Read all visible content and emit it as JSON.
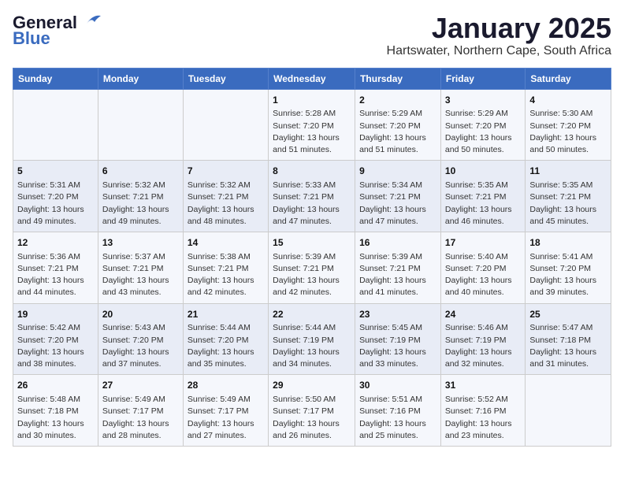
{
  "logo": {
    "line1": "General",
    "line2": "Blue"
  },
  "header": {
    "month": "January 2025",
    "location": "Hartswater, Northern Cape, South Africa"
  },
  "weekdays": [
    "Sunday",
    "Monday",
    "Tuesday",
    "Wednesday",
    "Thursday",
    "Friday",
    "Saturday"
  ],
  "weeks": [
    [
      {
        "day": "",
        "info": ""
      },
      {
        "day": "",
        "info": ""
      },
      {
        "day": "",
        "info": ""
      },
      {
        "day": "1",
        "info": "Sunrise: 5:28 AM\nSunset: 7:20 PM\nDaylight: 13 hours\nand 51 minutes."
      },
      {
        "day": "2",
        "info": "Sunrise: 5:29 AM\nSunset: 7:20 PM\nDaylight: 13 hours\nand 51 minutes."
      },
      {
        "day": "3",
        "info": "Sunrise: 5:29 AM\nSunset: 7:20 PM\nDaylight: 13 hours\nand 50 minutes."
      },
      {
        "day": "4",
        "info": "Sunrise: 5:30 AM\nSunset: 7:20 PM\nDaylight: 13 hours\nand 50 minutes."
      }
    ],
    [
      {
        "day": "5",
        "info": "Sunrise: 5:31 AM\nSunset: 7:20 PM\nDaylight: 13 hours\nand 49 minutes."
      },
      {
        "day": "6",
        "info": "Sunrise: 5:32 AM\nSunset: 7:21 PM\nDaylight: 13 hours\nand 49 minutes."
      },
      {
        "day": "7",
        "info": "Sunrise: 5:32 AM\nSunset: 7:21 PM\nDaylight: 13 hours\nand 48 minutes."
      },
      {
        "day": "8",
        "info": "Sunrise: 5:33 AM\nSunset: 7:21 PM\nDaylight: 13 hours\nand 47 minutes."
      },
      {
        "day": "9",
        "info": "Sunrise: 5:34 AM\nSunset: 7:21 PM\nDaylight: 13 hours\nand 47 minutes."
      },
      {
        "day": "10",
        "info": "Sunrise: 5:35 AM\nSunset: 7:21 PM\nDaylight: 13 hours\nand 46 minutes."
      },
      {
        "day": "11",
        "info": "Sunrise: 5:35 AM\nSunset: 7:21 PM\nDaylight: 13 hours\nand 45 minutes."
      }
    ],
    [
      {
        "day": "12",
        "info": "Sunrise: 5:36 AM\nSunset: 7:21 PM\nDaylight: 13 hours\nand 44 minutes."
      },
      {
        "day": "13",
        "info": "Sunrise: 5:37 AM\nSunset: 7:21 PM\nDaylight: 13 hours\nand 43 minutes."
      },
      {
        "day": "14",
        "info": "Sunrise: 5:38 AM\nSunset: 7:21 PM\nDaylight: 13 hours\nand 42 minutes."
      },
      {
        "day": "15",
        "info": "Sunrise: 5:39 AM\nSunset: 7:21 PM\nDaylight: 13 hours\nand 42 minutes."
      },
      {
        "day": "16",
        "info": "Sunrise: 5:39 AM\nSunset: 7:21 PM\nDaylight: 13 hours\nand 41 minutes."
      },
      {
        "day": "17",
        "info": "Sunrise: 5:40 AM\nSunset: 7:20 PM\nDaylight: 13 hours\nand 40 minutes."
      },
      {
        "day": "18",
        "info": "Sunrise: 5:41 AM\nSunset: 7:20 PM\nDaylight: 13 hours\nand 39 minutes."
      }
    ],
    [
      {
        "day": "19",
        "info": "Sunrise: 5:42 AM\nSunset: 7:20 PM\nDaylight: 13 hours\nand 38 minutes."
      },
      {
        "day": "20",
        "info": "Sunrise: 5:43 AM\nSunset: 7:20 PM\nDaylight: 13 hours\nand 37 minutes."
      },
      {
        "day": "21",
        "info": "Sunrise: 5:44 AM\nSunset: 7:20 PM\nDaylight: 13 hours\nand 35 minutes."
      },
      {
        "day": "22",
        "info": "Sunrise: 5:44 AM\nSunset: 7:19 PM\nDaylight: 13 hours\nand 34 minutes."
      },
      {
        "day": "23",
        "info": "Sunrise: 5:45 AM\nSunset: 7:19 PM\nDaylight: 13 hours\nand 33 minutes."
      },
      {
        "day": "24",
        "info": "Sunrise: 5:46 AM\nSunset: 7:19 PM\nDaylight: 13 hours\nand 32 minutes."
      },
      {
        "day": "25",
        "info": "Sunrise: 5:47 AM\nSunset: 7:18 PM\nDaylight: 13 hours\nand 31 minutes."
      }
    ],
    [
      {
        "day": "26",
        "info": "Sunrise: 5:48 AM\nSunset: 7:18 PM\nDaylight: 13 hours\nand 30 minutes."
      },
      {
        "day": "27",
        "info": "Sunrise: 5:49 AM\nSunset: 7:17 PM\nDaylight: 13 hours\nand 28 minutes."
      },
      {
        "day": "28",
        "info": "Sunrise: 5:49 AM\nSunset: 7:17 PM\nDaylight: 13 hours\nand 27 minutes."
      },
      {
        "day": "29",
        "info": "Sunrise: 5:50 AM\nSunset: 7:17 PM\nDaylight: 13 hours\nand 26 minutes."
      },
      {
        "day": "30",
        "info": "Sunrise: 5:51 AM\nSunset: 7:16 PM\nDaylight: 13 hours\nand 25 minutes."
      },
      {
        "day": "31",
        "info": "Sunrise: 5:52 AM\nSunset: 7:16 PM\nDaylight: 13 hours\nand 23 minutes."
      },
      {
        "day": "",
        "info": ""
      }
    ]
  ]
}
